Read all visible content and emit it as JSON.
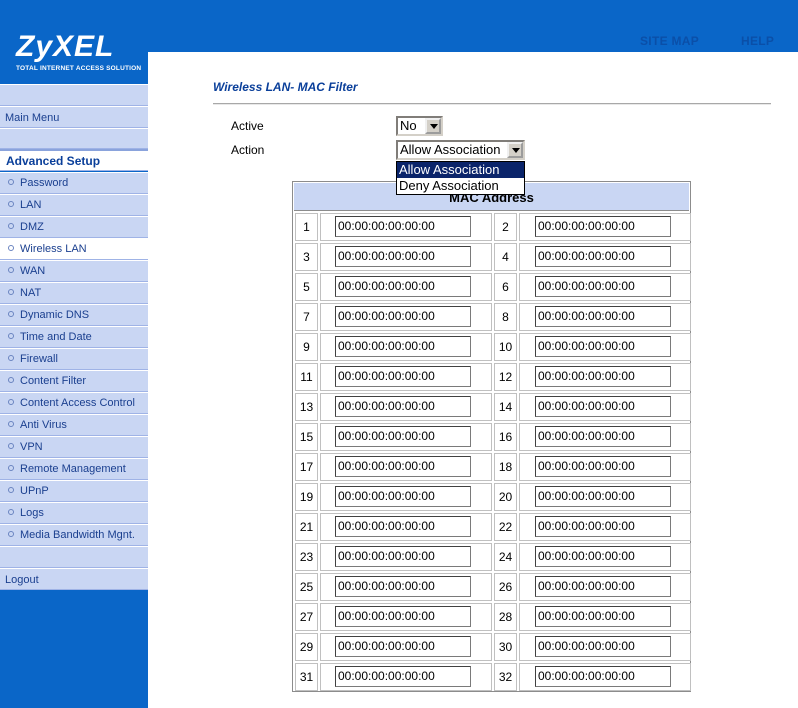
{
  "logo": {
    "name": "ZyXEL",
    "tagline": "TOTAL INTERNET ACCESS SOLUTION"
  },
  "toplinks": {
    "site_map": "SITE MAP",
    "help": "HELP"
  },
  "sidebar": {
    "main_menu": "Main Menu",
    "section_title": "Advanced Setup",
    "items": [
      {
        "label": "Password"
      },
      {
        "label": "LAN"
      },
      {
        "label": "DMZ"
      },
      {
        "label": "Wireless LAN",
        "selected": true
      },
      {
        "label": "WAN"
      },
      {
        "label": "NAT"
      },
      {
        "label": "Dynamic DNS"
      },
      {
        "label": "Time and Date"
      },
      {
        "label": "Firewall"
      },
      {
        "label": "Content Filter"
      },
      {
        "label": "Content Access Control"
      },
      {
        "label": "Anti Virus"
      },
      {
        "label": "VPN"
      },
      {
        "label": "Remote Management"
      },
      {
        "label": "UPnP"
      },
      {
        "label": "Logs"
      },
      {
        "label": "Media Bandwidth Mgnt."
      }
    ],
    "logout": "Logout"
  },
  "page": {
    "title": "Wireless LAN- MAC Filter",
    "active_label": "Active",
    "active_value": "No",
    "action_label": "Action",
    "action_value": "Allow Association",
    "action_options": [
      "Allow Association",
      "Deny Association"
    ],
    "action_highlighted": "Allow Association"
  },
  "mac_table": {
    "header": "MAC Address",
    "rows": [
      {
        "left": {
          "n": "1",
          "mac": "00:00:00:00:00:00"
        },
        "right": {
          "n": "2",
          "mac": "00:00:00:00:00:00"
        }
      },
      {
        "left": {
          "n": "3",
          "mac": "00:00:00:00:00:00"
        },
        "right": {
          "n": "4",
          "mac": "00:00:00:00:00:00"
        }
      },
      {
        "left": {
          "n": "5",
          "mac": "00:00:00:00:00:00"
        },
        "right": {
          "n": "6",
          "mac": "00:00:00:00:00:00"
        }
      },
      {
        "left": {
          "n": "7",
          "mac": "00:00:00:00:00:00"
        },
        "right": {
          "n": "8",
          "mac": "00:00:00:00:00:00"
        }
      },
      {
        "left": {
          "n": "9",
          "mac": "00:00:00:00:00:00"
        },
        "right": {
          "n": "10",
          "mac": "00:00:00:00:00:00"
        }
      },
      {
        "left": {
          "n": "11",
          "mac": "00:00:00:00:00:00"
        },
        "right": {
          "n": "12",
          "mac": "00:00:00:00:00:00"
        }
      },
      {
        "left": {
          "n": "13",
          "mac": "00:00:00:00:00:00"
        },
        "right": {
          "n": "14",
          "mac": "00:00:00:00:00:00"
        }
      },
      {
        "left": {
          "n": "15",
          "mac": "00:00:00:00:00:00"
        },
        "right": {
          "n": "16",
          "mac": "00:00:00:00:00:00"
        }
      },
      {
        "left": {
          "n": "17",
          "mac": "00:00:00:00:00:00"
        },
        "right": {
          "n": "18",
          "mac": "00:00:00:00:00:00"
        }
      },
      {
        "left": {
          "n": "19",
          "mac": "00:00:00:00:00:00"
        },
        "right": {
          "n": "20",
          "mac": "00:00:00:00:00:00"
        }
      },
      {
        "left": {
          "n": "21",
          "mac": "00:00:00:00:00:00"
        },
        "right": {
          "n": "22",
          "mac": "00:00:00:00:00:00"
        }
      },
      {
        "left": {
          "n": "23",
          "mac": "00:00:00:00:00:00"
        },
        "right": {
          "n": "24",
          "mac": "00:00:00:00:00:00"
        }
      },
      {
        "left": {
          "n": "25",
          "mac": "00:00:00:00:00:00"
        },
        "right": {
          "n": "26",
          "mac": "00:00:00:00:00:00"
        }
      },
      {
        "left": {
          "n": "27",
          "mac": "00:00:00:00:00:00"
        },
        "right": {
          "n": "28",
          "mac": "00:00:00:00:00:00"
        }
      },
      {
        "left": {
          "n": "29",
          "mac": "00:00:00:00:00:00"
        },
        "right": {
          "n": "30",
          "mac": "00:00:00:00:00:00"
        }
      },
      {
        "left": {
          "n": "31",
          "mac": "00:00:00:00:00:00"
        },
        "right": {
          "n": "32",
          "mac": "00:00:00:00:00:00"
        }
      }
    ]
  },
  "colors": {
    "brand_blue": "#0a66c8",
    "nav_bg": "#c9d6f3",
    "title_blue": "#0a3f9a",
    "highlight": "#0a246a"
  }
}
